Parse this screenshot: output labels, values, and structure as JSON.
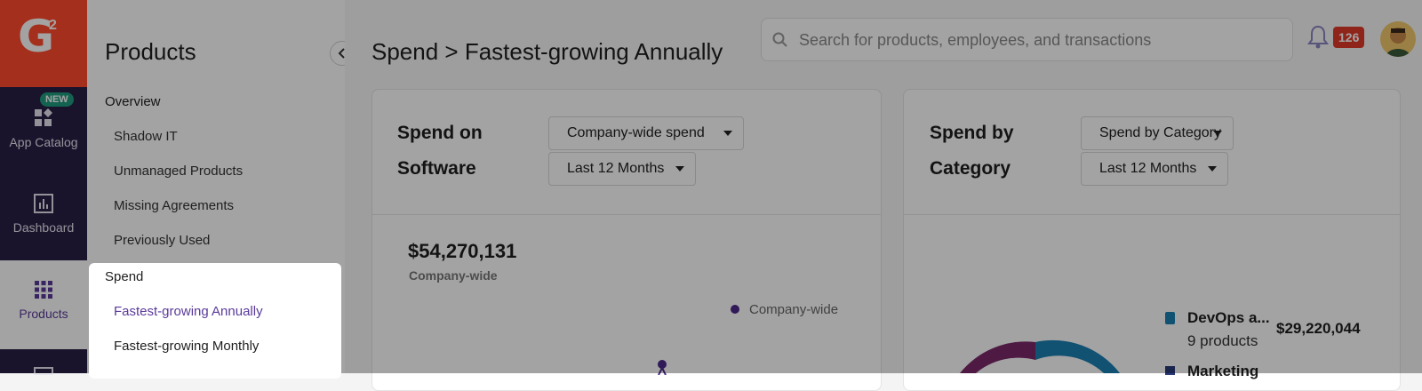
{
  "logo": {
    "letter": "G",
    "sup": "2"
  },
  "rail": {
    "new_badge": "NEW",
    "items": [
      {
        "label": "App Catalog"
      },
      {
        "label": "Dashboard"
      },
      {
        "label": "Products"
      }
    ]
  },
  "sidenav": {
    "title": "Products",
    "overview": "Overview",
    "items": [
      "Shadow IT",
      "Unmanaged Products",
      "Missing Agreements",
      "Previously Used"
    ]
  },
  "popup": {
    "section": "Spend",
    "items": [
      "Fastest-growing Annually",
      "Fastest-growing Monthly"
    ]
  },
  "header": {
    "title": "Spend > Fastest-growing Annually",
    "search_placeholder": "Search for products, employees, and transactions",
    "notifications": "126"
  },
  "card1": {
    "title_line1": "Spend on",
    "title_line2": "Software",
    "dropdown1": "Company-wide spend",
    "dropdown2": "Last 12 Months",
    "total": "$54,270,131",
    "total_label": "Company-wide",
    "legend": "Company-wide"
  },
  "card2": {
    "title_line1": "Spend by",
    "title_line2": "Category",
    "dropdown1": "Spend by Category",
    "dropdown2": "Last 12 Months",
    "category1_name": "DevOps a...",
    "category1_count": "9 products",
    "category1_amount": "$29,220,044",
    "category2_name": "Marketing"
  },
  "colors": {
    "brand": "#ff4a2c",
    "rail": "#2a1f45",
    "accent": "#5a3a9a",
    "donut_primary": "#1b7fb3",
    "donut_secondary": "#7a2a6a"
  }
}
